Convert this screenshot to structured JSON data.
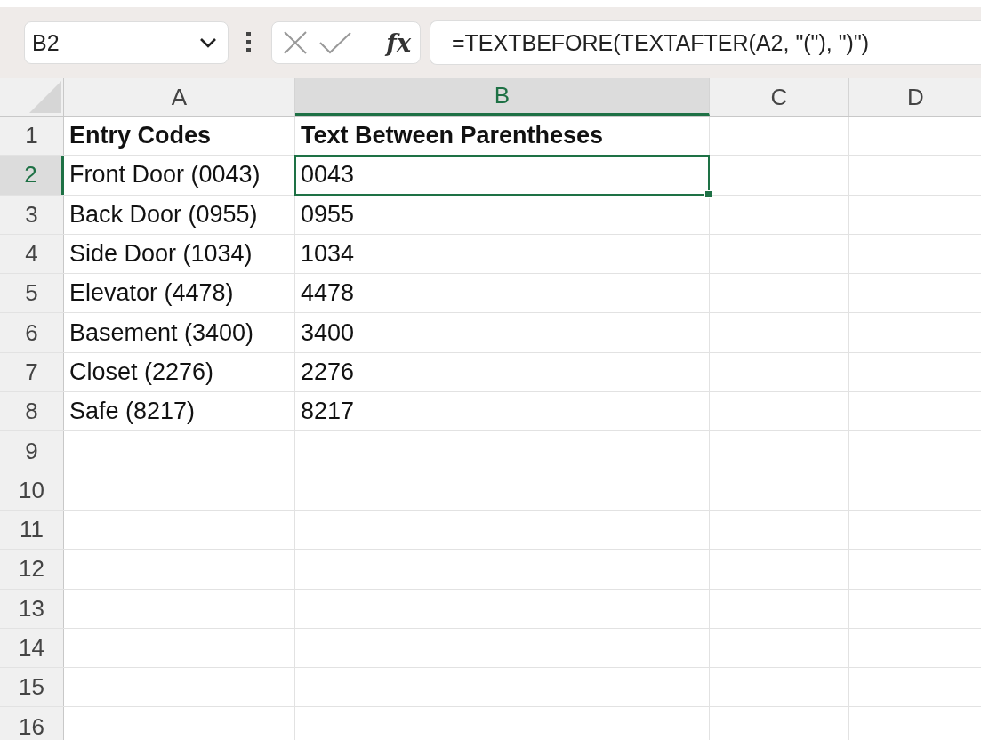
{
  "name_box": {
    "value": "B2"
  },
  "formula_bar": {
    "function_label": "fx",
    "formula": "=TEXTBEFORE(TEXTAFTER(A2, \"(\"), \")\")"
  },
  "columns": [
    {
      "label": "A",
      "selected": false
    },
    {
      "label": "B",
      "selected": true
    },
    {
      "label": "C",
      "selected": false
    },
    {
      "label": "D",
      "selected": false
    }
  ],
  "rows": [
    {
      "number": "1",
      "kind": "header",
      "selected": false,
      "cells": [
        {
          "text": "Entry Codes",
          "selected": false
        },
        {
          "text": "Text Between Parentheses",
          "selected": false
        }
      ]
    },
    {
      "number": "2",
      "kind": "data",
      "selected": true,
      "cells": [
        {
          "text": "Front Door (0043)",
          "selected": false
        },
        {
          "text": "0043",
          "selected": true
        }
      ]
    },
    {
      "number": "3",
      "kind": "data",
      "selected": false,
      "cells": [
        {
          "text": "Back Door (0955)",
          "selected": false
        },
        {
          "text": "0955",
          "selected": false
        }
      ]
    },
    {
      "number": "4",
      "kind": "data",
      "selected": false,
      "cells": [
        {
          "text": "Side Door (1034)",
          "selected": false
        },
        {
          "text": "1034",
          "selected": false
        }
      ]
    },
    {
      "number": "5",
      "kind": "data",
      "selected": false,
      "cells": [
        {
          "text": "Elevator (4478)",
          "selected": false
        },
        {
          "text": "4478",
          "selected": false
        }
      ]
    },
    {
      "number": "6",
      "kind": "data",
      "selected": false,
      "cells": [
        {
          "text": "Basement (3400)",
          "selected": false
        },
        {
          "text": "3400",
          "selected": false
        }
      ]
    },
    {
      "number": "7",
      "kind": "data",
      "selected": false,
      "cells": [
        {
          "text": "Closet (2276)",
          "selected": false
        },
        {
          "text": "2276",
          "selected": false
        }
      ]
    },
    {
      "number": "8",
      "kind": "data",
      "selected": false,
      "cells": [
        {
          "text": "Safe (8217)",
          "selected": false
        },
        {
          "text": "8217",
          "selected": false
        }
      ]
    },
    {
      "number": "9",
      "kind": "data",
      "selected": false
    },
    {
      "number": "10",
      "kind": "data",
      "selected": false
    },
    {
      "number": "11",
      "kind": "data",
      "selected": false
    },
    {
      "number": "12",
      "kind": "data",
      "selected": false
    },
    {
      "number": "13",
      "kind": "data",
      "selected": false
    },
    {
      "number": "14",
      "kind": "data",
      "selected": false
    },
    {
      "number": "15",
      "kind": "data",
      "selected": false
    },
    {
      "number": "16",
      "kind": "data",
      "selected": false
    }
  ]
}
